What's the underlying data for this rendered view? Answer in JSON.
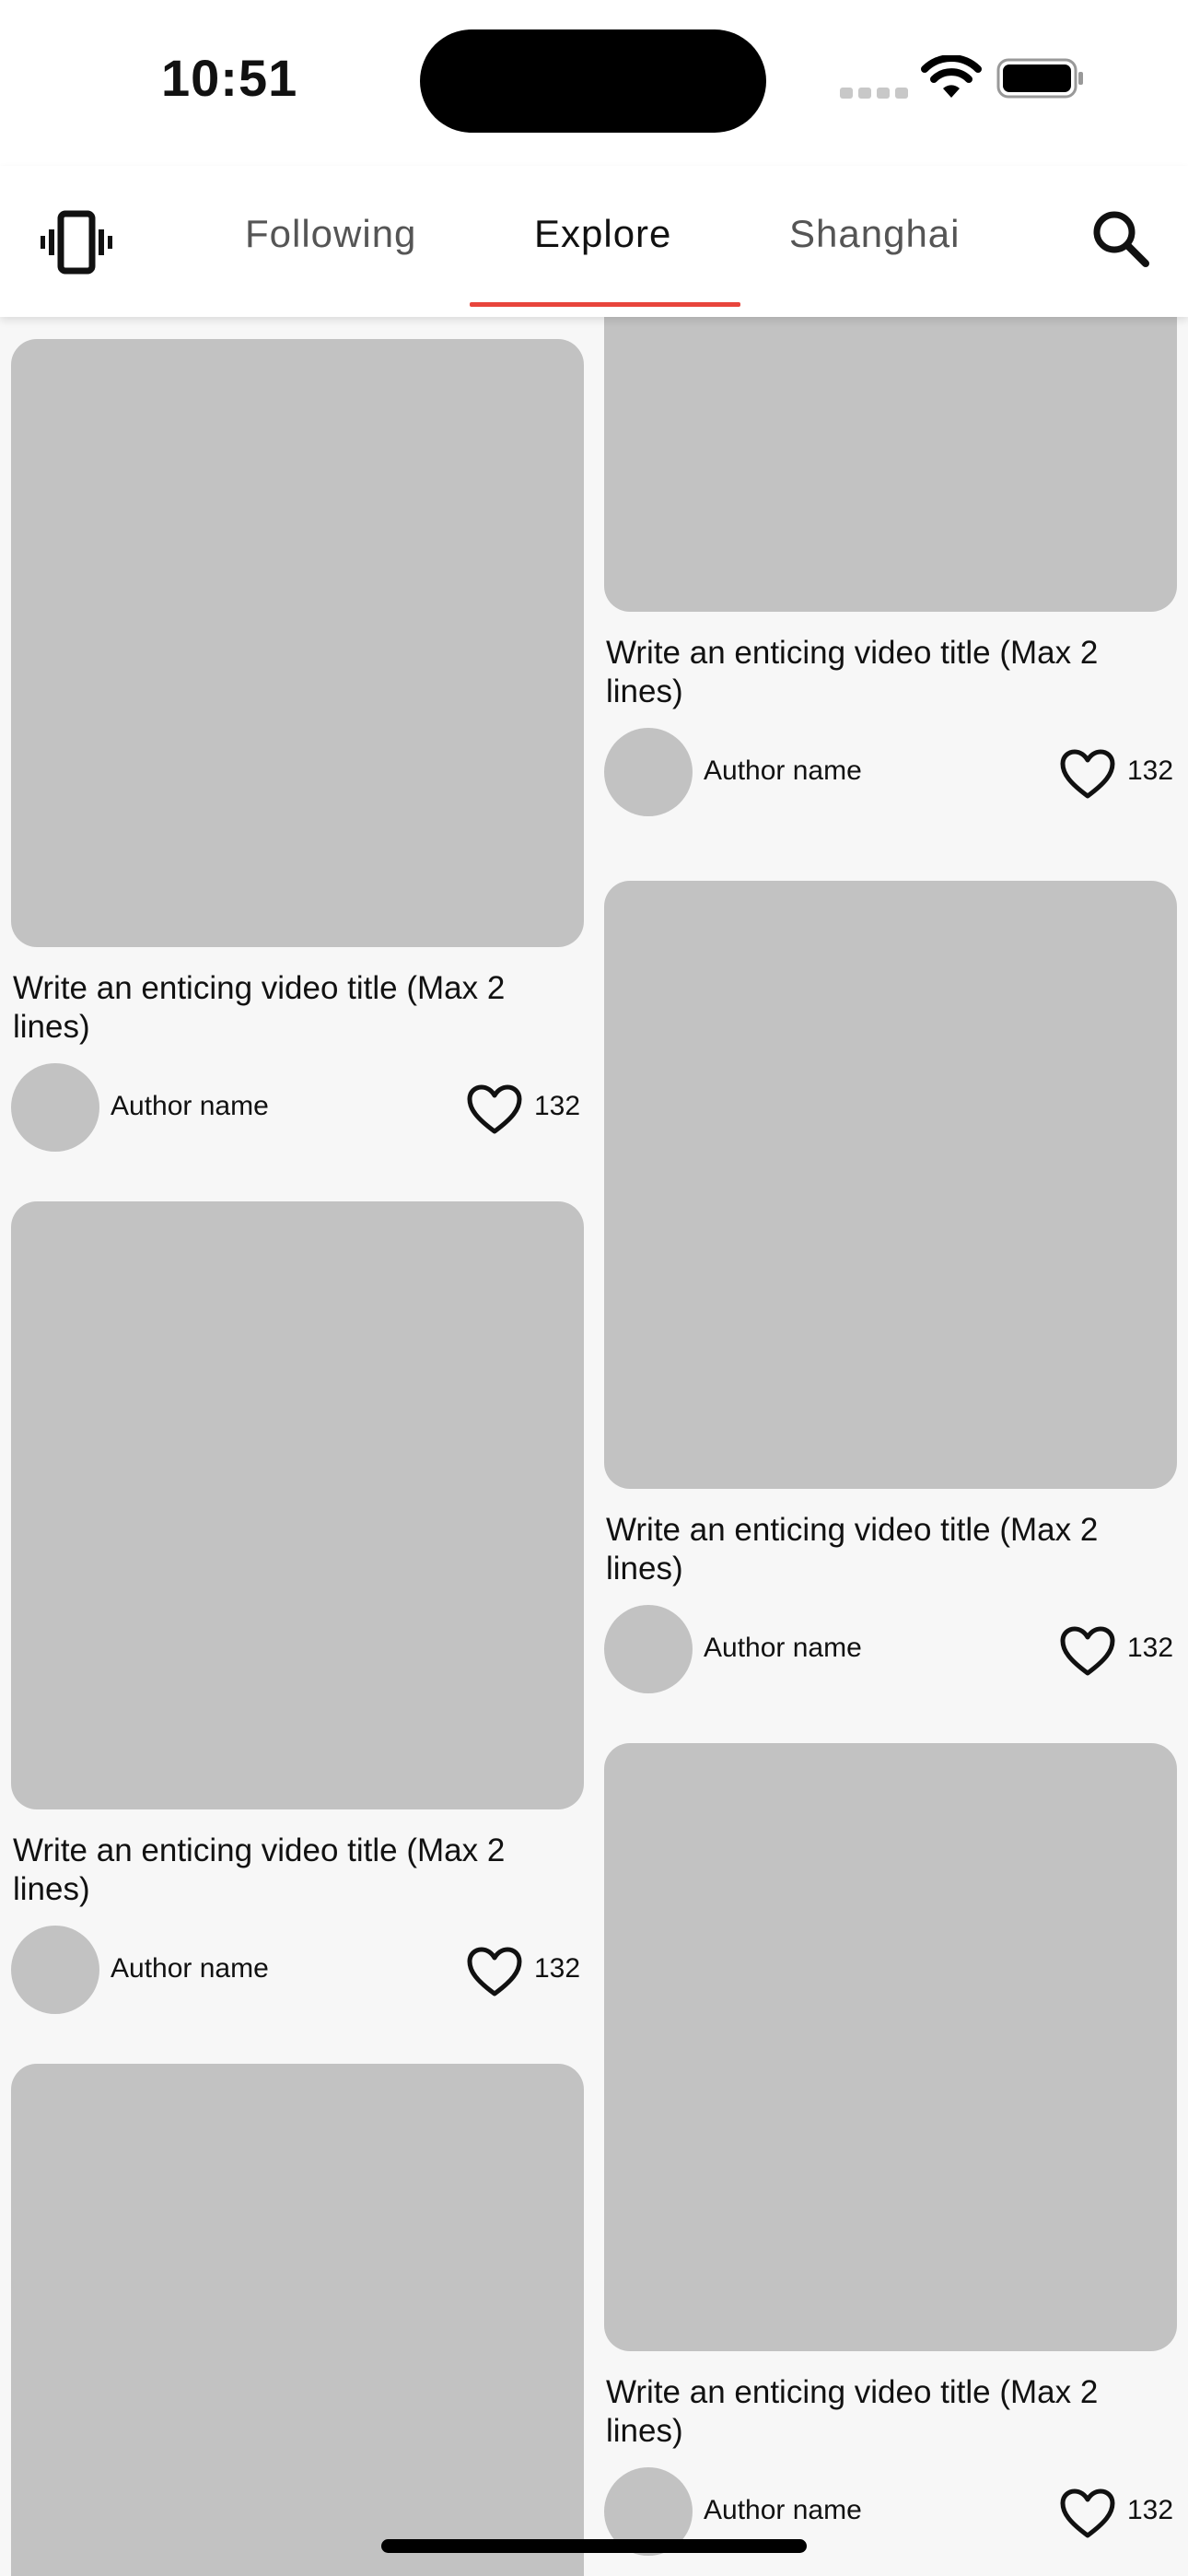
{
  "status_bar": {
    "time": "10:51"
  },
  "nav": {
    "tabs": [
      {
        "label": "Following",
        "active": false
      },
      {
        "label": "Explore",
        "active": true
      },
      {
        "label": "Shanghai",
        "active": false
      }
    ],
    "accent_color": "#e8453c",
    "icons": {
      "left": "vibrate-icon",
      "right": "search-icon"
    }
  },
  "feed": {
    "left_column": [
      {
        "title": "Write an enticing video title (Max 2 lines)",
        "author": "Author name",
        "likes": "132"
      },
      {
        "title": "Write an enticing video title (Max 2 lines)",
        "author": "Author name",
        "likes": "132"
      },
      {
        "title": "",
        "author": "",
        "likes": ""
      }
    ],
    "right_column": [
      {
        "title": "Write an enticing video title (Max 2 lines)",
        "author": "Author name",
        "likes": "132"
      },
      {
        "title": "Write an enticing video title (Max 2 lines)",
        "author": "Author name",
        "likes": "132"
      },
      {
        "title": "Write an enticing video title (Max 2 lines)",
        "author": "Author name",
        "likes": "132"
      }
    ]
  }
}
